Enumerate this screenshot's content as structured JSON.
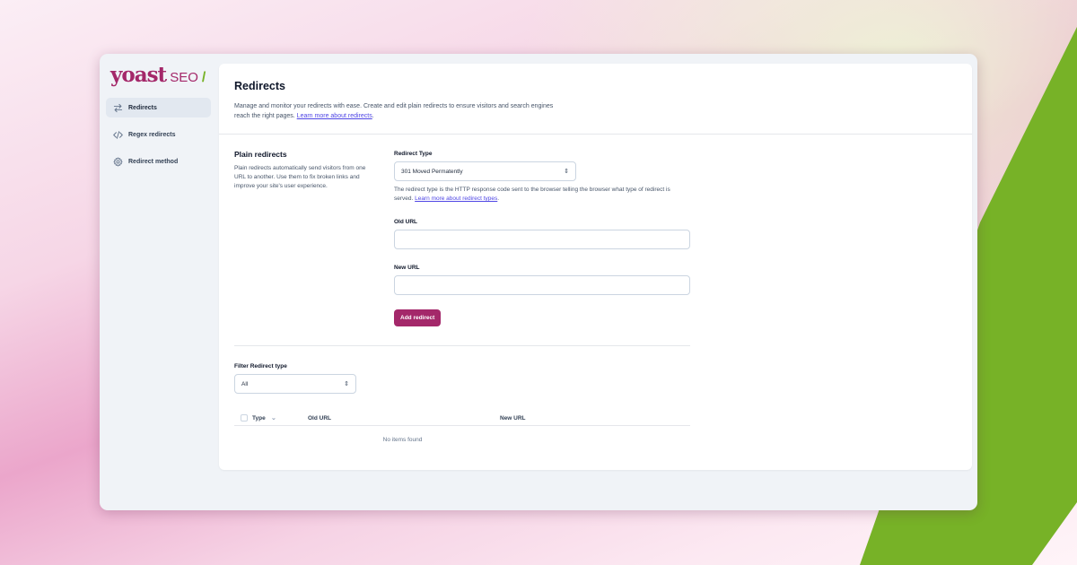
{
  "brand": {
    "name": "yoast",
    "product": "SEO",
    "slash": "/",
    "accent": "#a4286a",
    "green": "#77b227"
  },
  "sidebar": {
    "items": [
      {
        "label": "Redirects",
        "icon": "arrows-right-left-icon",
        "active": true
      },
      {
        "label": "Regex redirects",
        "icon": "code-icon",
        "active": false
      },
      {
        "label": "Redirect method",
        "icon": "gear-icon",
        "active": false
      }
    ]
  },
  "header": {
    "title": "Redirects",
    "description": "Manage and monitor your redirects with ease. Create and edit plain redirects to ensure visitors and search engines reach the right pages.",
    "link": "Learn more about redirects"
  },
  "plain": {
    "title": "Plain redirects",
    "description": "Plain redirects automatically send visitors from one URL to another. Use them to fix broken links and improve your site's user experience."
  },
  "form": {
    "redirect_type_label": "Redirect Type",
    "redirect_type_value": "301 Moved Permatently",
    "redirect_type_help": "The redirect type is the HTTP response code sent to the browser telling the browser what type of redirect is served.",
    "redirect_type_link": "Learn more about redirect types",
    "old_url_label": "Old URL",
    "old_url_value": "",
    "new_url_label": "New URL",
    "new_url_value": "",
    "submit_label": "Add redirect"
  },
  "filter": {
    "label": "Filter Redirect type",
    "value": "All"
  },
  "table": {
    "columns": [
      "Type",
      "Old URL",
      "New URL"
    ],
    "empty_text": "No items found"
  }
}
